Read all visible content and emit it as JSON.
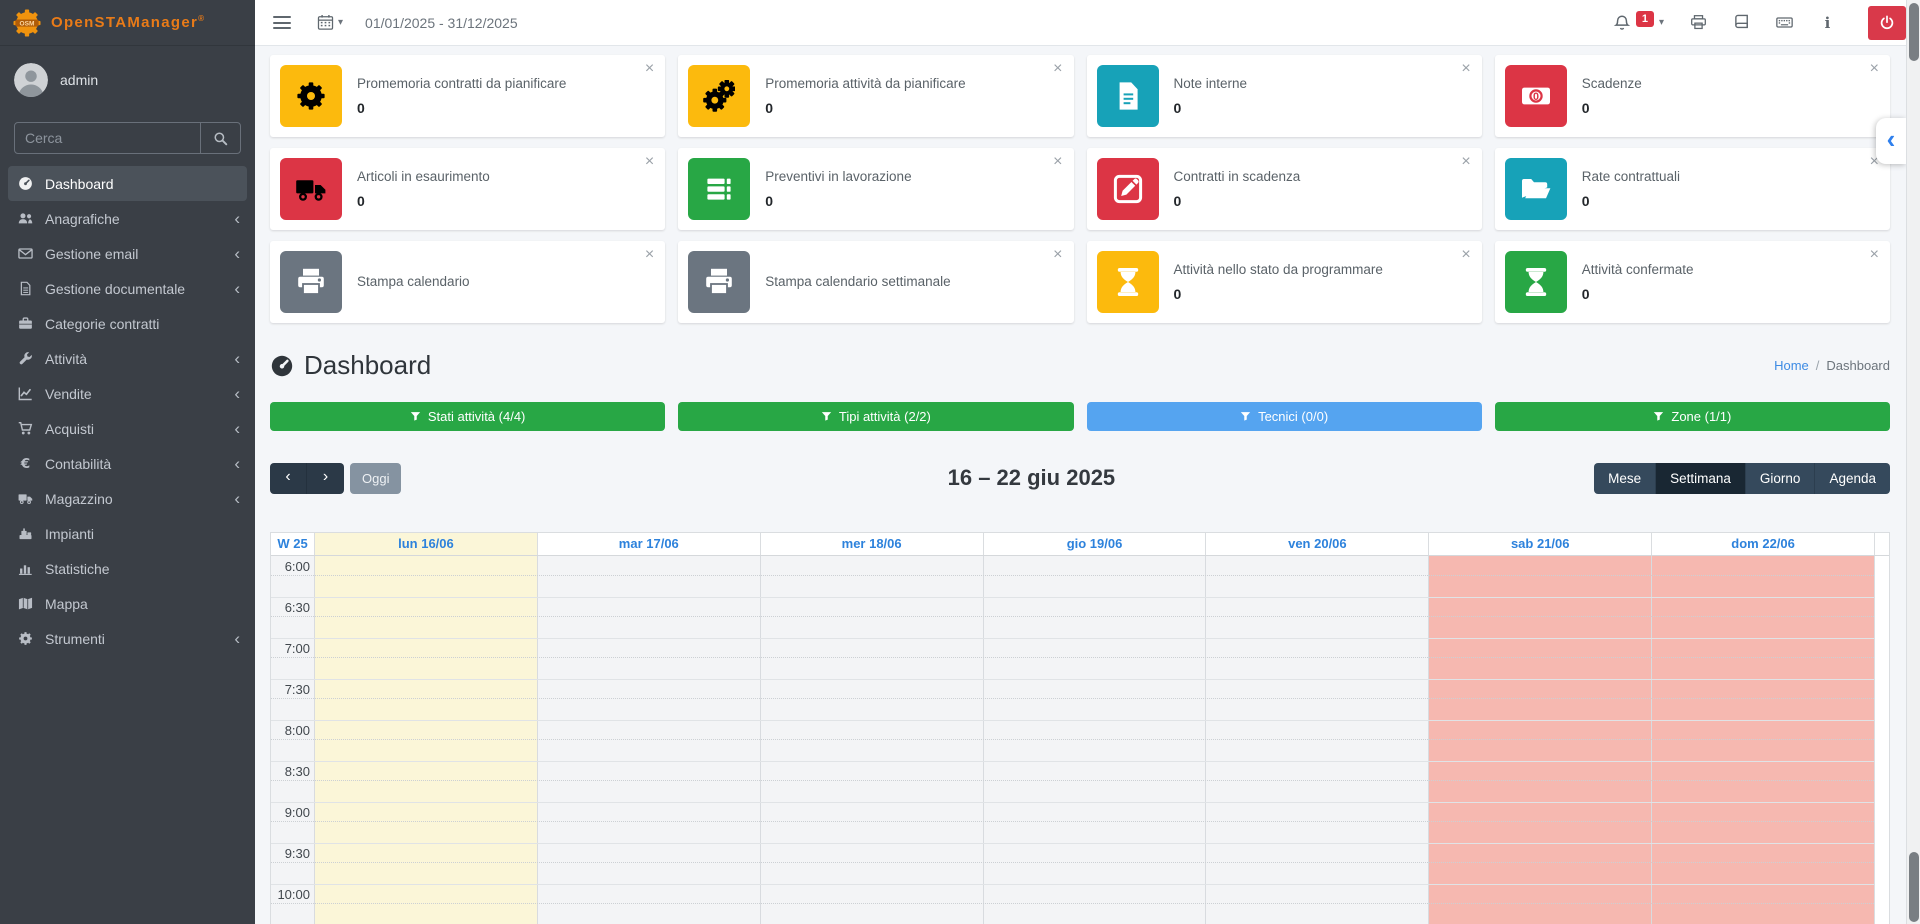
{
  "brand": {
    "name": "OpenSTAManager",
    "registered": "®",
    "logo_icon": "osm-gear-logo"
  },
  "sidebar": {
    "user": {
      "name": "admin",
      "avatar_icon": "user-avatar"
    },
    "search": {
      "placeholder": "Cerca",
      "icon": "search-icon"
    },
    "items": [
      {
        "id": "dashboard",
        "label": "Dashboard",
        "icon": "speedometer-icon",
        "active": true,
        "has_submenu": false
      },
      {
        "id": "anagrafiche",
        "label": "Anagrafiche",
        "icon": "users-icon",
        "active": false,
        "has_submenu": true
      },
      {
        "id": "gestione-email",
        "label": "Gestione email",
        "icon": "envelope-icon",
        "active": false,
        "has_submenu": true
      },
      {
        "id": "gestione-documentale",
        "label": "Gestione documentale",
        "icon": "document-icon",
        "active": false,
        "has_submenu": true
      },
      {
        "id": "categorie-contratti",
        "label": "Categorie contratti",
        "icon": "briefcase-icon",
        "active": false,
        "has_submenu": false
      },
      {
        "id": "attivita",
        "label": "Attività",
        "icon": "wrench-icon",
        "active": false,
        "has_submenu": true
      },
      {
        "id": "vendite",
        "label": "Vendite",
        "icon": "chart-line-icon",
        "active": false,
        "has_submenu": true
      },
      {
        "id": "acquisti",
        "label": "Acquisti",
        "icon": "cart-icon",
        "active": false,
        "has_submenu": true
      },
      {
        "id": "contabilita",
        "label": "Contabilità",
        "icon": "euro-icon",
        "active": false,
        "has_submenu": true
      },
      {
        "id": "magazzino",
        "label": "Magazzino",
        "icon": "truck-icon",
        "active": false,
        "has_submenu": true
      },
      {
        "id": "impianti",
        "label": "Impianti",
        "icon": "machine-icon",
        "active": false,
        "has_submenu": false
      },
      {
        "id": "statistiche",
        "label": "Statistiche",
        "icon": "bar-chart-icon",
        "active": false,
        "has_submenu": false
      },
      {
        "id": "mappa",
        "label": "Mappa",
        "icon": "map-icon",
        "active": false,
        "has_submenu": false
      },
      {
        "id": "strumenti",
        "label": "Strumenti",
        "icon": "gear-icon",
        "active": false,
        "has_submenu": true
      }
    ]
  },
  "topbar": {
    "menu_icon": "hamburger-icon",
    "period": {
      "icon": "calendar-icon",
      "caret_icon": "caret-down-icon",
      "date_range": "01/01/2025 - 31/12/2025"
    },
    "notifications": {
      "icon": "bell-icon",
      "count": "1",
      "caret_icon": "caret-down-icon"
    },
    "action_icons": [
      "printer-icon",
      "book-icon",
      "keyboard-icon",
      "info-icon"
    ],
    "logout_icon": "power-icon",
    "logout_color": "#d9394a"
  },
  "widgets": [
    {
      "id": "promemoria-contratti",
      "label": "Promemoria contratti da pianificare",
      "count": "0",
      "color": "#fcba0d",
      "icon": "gear-icon"
    },
    {
      "id": "promemoria-attivita",
      "label": "Promemoria attività da pianificare",
      "count": "0",
      "color": "#fcba0d",
      "icon": "gears-icon"
    },
    {
      "id": "note-interne",
      "label": "Note interne",
      "count": "0",
      "color": "#17a2b8",
      "icon": "note-icon"
    },
    {
      "id": "scadenze",
      "label": "Scadenze",
      "count": "0",
      "color": "#dc3545",
      "icon": "money-icon"
    },
    {
      "id": "articoli-esaurimento",
      "label": "Articoli in esaurimento",
      "count": "0",
      "color": "#dc3545",
      "icon": "truck-icon"
    },
    {
      "id": "preventivi-lavorazione",
      "label": "Preventivi in lavorazione",
      "count": "0",
      "color": "#28a745",
      "icon": "tasks-icon"
    },
    {
      "id": "contratti-scadenza",
      "label": "Contratti in scadenza",
      "count": "0",
      "color": "#dc3545",
      "icon": "pen-square-icon"
    },
    {
      "id": "rate-contrattuali",
      "label": "Rate contrattuali",
      "count": "0",
      "color": "#17a2b8",
      "icon": "folder-open-icon"
    },
    {
      "id": "stampa-calendario",
      "label": "Stampa calendario",
      "count": null,
      "color": "#6b7580",
      "icon": "printer-icon"
    },
    {
      "id": "stampa-calendario-settimanale",
      "label": "Stampa calendario settimanale",
      "count": null,
      "color": "#6b7580",
      "icon": "printer-icon"
    },
    {
      "id": "attivita-da-programmare",
      "label": "Attività nello stato da programmare",
      "count": "0",
      "color": "#fcba0d",
      "icon": "hourglass-icon"
    },
    {
      "id": "attivita-confermate",
      "label": "Attività confermate",
      "count": "0",
      "color": "#28a745",
      "icon": "hourglass-icon"
    }
  ],
  "page": {
    "title": "Dashboard",
    "title_icon": "speedometer-icon",
    "breadcrumb": {
      "home": "Home",
      "separator": "/",
      "current": "Dashboard"
    }
  },
  "filters": [
    {
      "id": "stati-attivita",
      "label": "Stati attività (4/4)",
      "color": "#28a745",
      "icon": "filter-icon"
    },
    {
      "id": "tipi-attivita",
      "label": "Tipi attività (2/2)",
      "color": "#28a745",
      "icon": "filter-icon"
    },
    {
      "id": "tecnici",
      "label": "Tecnici (0/0)",
      "color": "#55a4f0",
      "icon": "filter-icon"
    },
    {
      "id": "zone",
      "label": "Zone (1/1)",
      "color": "#28a745",
      "icon": "filter-icon"
    }
  ],
  "calendar": {
    "prev_icon": "chevron-left-icon",
    "next_icon": "chevron-right-icon",
    "today_label": "Oggi",
    "title": "16 – 22 giu 2025",
    "views": [
      "Mese",
      "Settimana",
      "Giorno",
      "Agenda"
    ],
    "active_view": "Settimana",
    "week_label": "W 25",
    "days": [
      {
        "label": "lun 16/06",
        "kind": "today"
      },
      {
        "label": "mar 17/06",
        "kind": "weekday"
      },
      {
        "label": "mer 18/06",
        "kind": "weekday"
      },
      {
        "label": "gio 19/06",
        "kind": "weekday"
      },
      {
        "label": "ven 20/06",
        "kind": "weekday"
      },
      {
        "label": "sab 21/06",
        "kind": "weekend"
      },
      {
        "label": "dom 22/06",
        "kind": "weekend"
      }
    ],
    "times": [
      "6:00",
      "6:30",
      "7:00",
      "7:30",
      "8:00",
      "8:30",
      "9:00",
      "9:30",
      "10:00"
    ],
    "colors": {
      "today_bg": "#fbf6d8",
      "weekend_bg": "#f6b8b0",
      "weekday_bg": "#f3f4f6",
      "header_link": "#2d82dc"
    }
  }
}
